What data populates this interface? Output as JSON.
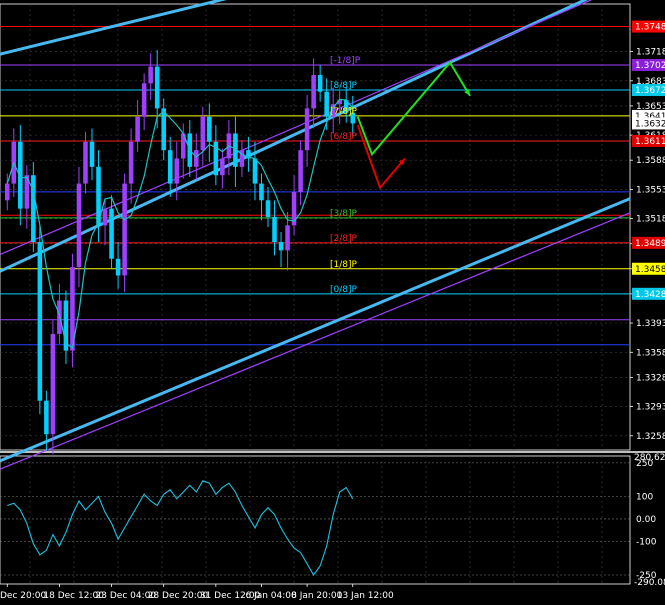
{
  "chart_data": [
    {
      "type": "candlestick",
      "x_tick_labels": [
        "Dec 20:00",
        "18 Dec 12:00",
        "23 Dec 04:00",
        "28 Dec 20:00",
        "31 Dec 12:00",
        "6 Jan 04:00",
        "8 Jan 20:00",
        "13 Jan 12:00"
      ],
      "y_tick_labels": [
        "1.3718",
        "1.3683",
        "1.3653",
        "1.3618",
        "1.3588",
        "1.3553",
        "1.3518",
        "1.3488",
        "1.3458",
        "1.3428",
        "1.3393",
        "1.3358",
        "1.3328",
        "1.3293",
        "1.3258"
      ],
      "ylim": [
        1.3241,
        1.3775
      ],
      "price_badges": [
        {
          "text": "1.3748",
          "value": 1.3748,
          "bg": "#ff0000",
          "fg": "#ffffff"
        },
        {
          "text": "1.3702",
          "value": 1.3702,
          "bg": "#8a1fd6",
          "fg": "#ffffff"
        },
        {
          "text": "1.3672",
          "value": 1.3672,
          "bg": "#00c8e8",
          "fg": "#ffffff"
        },
        {
          "text": "1.3641",
          "value": 1.3641,
          "bg": "#ffffff",
          "fg": "#000000"
        },
        {
          "text": "1.3632",
          "value": 1.3632,
          "bg": "#ffffff",
          "fg": "#000000"
        },
        {
          "text": "1.3611",
          "value": 1.3611,
          "bg": "#e00000",
          "fg": "#ffffff"
        },
        {
          "text": "1.3489",
          "value": 1.3489,
          "bg": "#e00000",
          "fg": "#ffffff"
        },
        {
          "text": "1.3458",
          "value": 1.3458,
          "bg": "#ffff00",
          "fg": "#000000"
        },
        {
          "text": "1.3428",
          "value": 1.3428,
          "bg": "#00c8e8",
          "fg": "#ffffff"
        }
      ],
      "murrey_levels": [
        {
          "label": "[-1/8]P",
          "value": 1.3702,
          "color": "#a040ff"
        },
        {
          "label": "[8/8]P",
          "value": 1.3672,
          "color": "#00d0ff"
        },
        {
          "label": "[7/8]P",
          "value": 1.3641,
          "color": "#ffff00"
        },
        {
          "label": "[6/8]P",
          "value": 1.3611,
          "color": "#ff2020"
        },
        {
          "label": "[3/8]P",
          "value": 1.3519,
          "color": "#30c030"
        },
        {
          "label": "[2/8]P",
          "value": 1.3489,
          "color": "#ff2020"
        },
        {
          "label": "[1/8]P",
          "value": 1.3458,
          "color": "#ffff00"
        },
        {
          "label": "[0/8]P",
          "value": 1.3428,
          "color": "#00d0ff"
        }
      ],
      "horizontal_lines": [
        {
          "value": 1.3748,
          "color": "#ff0000"
        },
        {
          "value": 1.3702,
          "color": "#a040ff"
        },
        {
          "value": 1.3672,
          "color": "#00d0ff"
        },
        {
          "value": 1.3641,
          "color": "#ffff00"
        },
        {
          "value": 1.3611,
          "color": "#ff2020"
        },
        {
          "value": 1.355,
          "color": "#2040ff"
        },
        {
          "value": 1.3522,
          "color": "#ff0000"
        },
        {
          "value": 1.3519,
          "color": "#30c030"
        },
        {
          "value": 1.3489,
          "color": "#ff2020"
        },
        {
          "value": 1.3458,
          "color": "#ffff00"
        },
        {
          "value": 1.3428,
          "color": "#00d0ff"
        },
        {
          "value": 1.3397,
          "color": "#a040ff"
        },
        {
          "value": 1.3367,
          "color": "#2040ff"
        }
      ],
      "colors": {
        "bull": "#a040ff",
        "bear": "#00d0ff",
        "ma": "#20c0c0",
        "channel": "#48b8f0",
        "channel_alt": "#a040ff",
        "forecast_up": "#20e020",
        "forecast_down": "#e00000",
        "grid": "#404040"
      }
    },
    {
      "type": "line",
      "name": "oscillator",
      "y_tick_labels": [
        "250",
        "100",
        "0.00",
        "-100",
        "-250"
      ],
      "top_label": "280.6215",
      "bottom_label": "-290.0846",
      "ylim": [
        -290.0846,
        280.6215
      ],
      "levels": [
        250,
        100,
        0,
        -100,
        -250
      ],
      "values": [
        60,
        70,
        40,
        -20,
        -110,
        -160,
        -140,
        -70,
        -120,
        -60,
        20,
        80,
        40,
        70,
        100,
        30,
        -20,
        -90,
        -40,
        10,
        60,
        110,
        80,
        60,
        110,
        130,
        90,
        120,
        150,
        120,
        170,
        160,
        110,
        140,
        160,
        120,
        60,
        10,
        -40,
        20,
        50,
        20,
        -40,
        -90,
        -130,
        -150,
        -200,
        -250,
        -210,
        -120,
        20,
        120,
        140,
        90
      ]
    }
  ]
}
